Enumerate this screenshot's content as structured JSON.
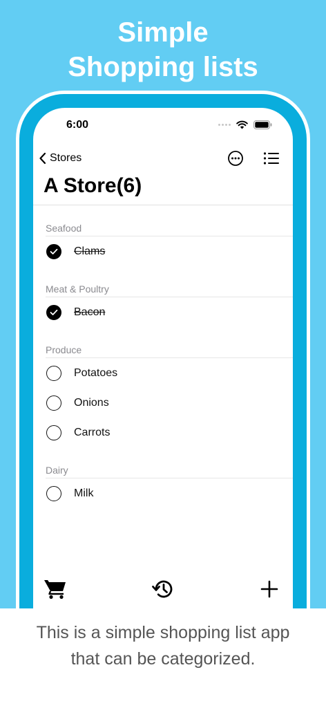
{
  "promo": {
    "headline_line1": "Simple",
    "headline_line2": "Shopping lists",
    "caption_line1": "This is a simple shopping list app",
    "caption_line2_pre": "that ",
    "caption_line2_highlight": "can be categorized",
    "caption_line2_post": "."
  },
  "status_bar": {
    "time": "6:00"
  },
  "nav": {
    "back_label": "Stores"
  },
  "page": {
    "title": "A Store(6)"
  },
  "sections": [
    {
      "header": "Seafood",
      "items": [
        {
          "label": "Clams",
          "checked": true
        }
      ]
    },
    {
      "header": "Meat & Poultry",
      "items": [
        {
          "label": "Bacon",
          "checked": true
        }
      ]
    },
    {
      "header": "Produce",
      "items": [
        {
          "label": "Potatoes",
          "checked": false
        },
        {
          "label": "Onions",
          "checked": false
        },
        {
          "label": "Carrots",
          "checked": false
        }
      ]
    },
    {
      "header": "Dairy",
      "items": [
        {
          "label": "Milk",
          "checked": false
        }
      ]
    }
  ],
  "icons": {
    "back": "chevron-left-icon",
    "more": "ellipsis-circle-icon",
    "list": "list-bullet-icon",
    "cart": "cart-icon",
    "history": "history-icon",
    "add": "plus-icon"
  },
  "colors": {
    "accent": "#62cdf3",
    "phone_ring": "#0aaddd",
    "highlight": "#bfe9f8"
  }
}
